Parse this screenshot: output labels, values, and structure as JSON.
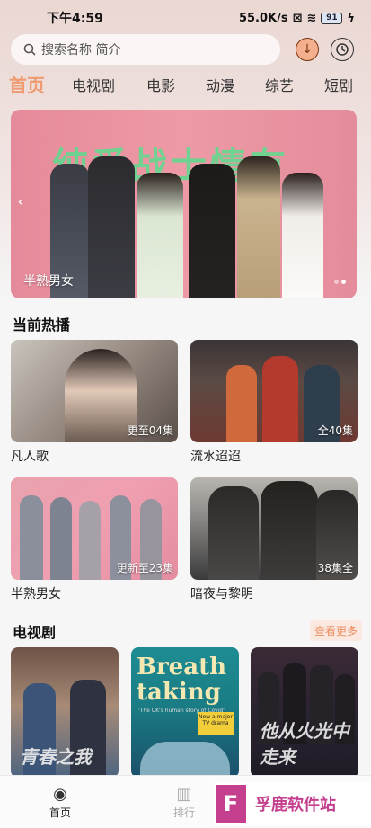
{
  "status_bar": {
    "time": "下午4:59",
    "network_speed": "55.0K/s",
    "battery": "91"
  },
  "search": {
    "placeholder": "搜索名称 简介"
  },
  "tabs": [
    {
      "label": "首页",
      "active": true
    },
    {
      "label": "电视剧",
      "active": false
    },
    {
      "label": "电影",
      "active": false
    },
    {
      "label": "动漫",
      "active": false
    },
    {
      "label": "综艺",
      "active": false
    },
    {
      "label": "短剧",
      "active": false
    }
  ],
  "banner": {
    "poster_title": "纯爱战士情有",
    "caption": "半熟男女",
    "slides": 2,
    "current_slide": 2
  },
  "now_playing": {
    "title": "当前热播",
    "items": [
      {
        "title": "凡人歌",
        "badge": "更至04集"
      },
      {
        "title": "流水迢迢",
        "badge": "全40集"
      },
      {
        "title": "半熟男女",
        "badge": "更新至23集"
      },
      {
        "title": "暗夜与黎明",
        "badge": "38集全"
      }
    ]
  },
  "tv_section": {
    "title": "电视剧",
    "see_more": "查看更多",
    "posters": [
      {
        "art_title": "青春之我"
      },
      {
        "art_title": "Breath taking",
        "tagline": "'The UK's human story of Covid'",
        "badge_text": "Now a major TV drama"
      },
      {
        "art_title": "他从火光中走来"
      }
    ]
  },
  "bottom_nav": [
    {
      "label": "首页",
      "icon": "home-icon"
    },
    {
      "label": "排行",
      "icon": "ranking-icon"
    }
  ],
  "watermark": {
    "logo_letter": "F",
    "text": "孚鹿软件站"
  },
  "colors": {
    "accent": "#ef9a70",
    "see_more": "#e98d5e",
    "watermark": "#c43f8e"
  }
}
